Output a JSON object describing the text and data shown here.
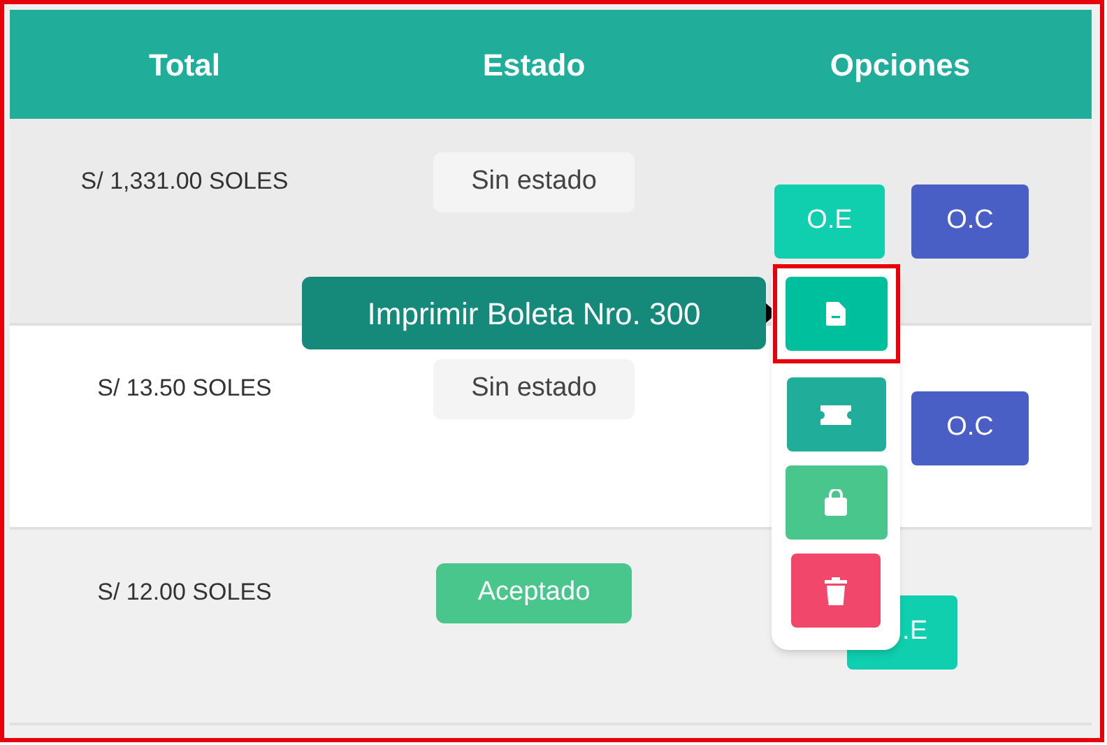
{
  "table": {
    "columns": [
      "Total",
      "Estado",
      "Opciones"
    ],
    "rows": [
      {
        "total": "S/ 1,331.00 SOLES",
        "status": {
          "label": "Sin estado",
          "kind": "none"
        },
        "options": [
          {
            "label": "O.E",
            "kind": "oe"
          },
          {
            "label": "O.C",
            "kind": "oc"
          }
        ]
      },
      {
        "total": "S/ 13.50 SOLES",
        "status": {
          "label": "Sin estado",
          "kind": "none"
        },
        "options": [
          {
            "label": "O.C",
            "kind": "oc"
          }
        ]
      },
      {
        "total": "S/ 12.00 SOLES",
        "status": {
          "label": "Aceptado",
          "kind": "accepted"
        },
        "options": [
          {
            "label": ".E",
            "kind": "oe"
          }
        ]
      }
    ]
  },
  "actions_menu": {
    "items": [
      {
        "kind": "document",
        "highlighted": true
      },
      {
        "kind": "ticket",
        "highlighted": false
      },
      {
        "kind": "bag",
        "highlighted": false
      },
      {
        "kind": "trash",
        "highlighted": false
      }
    ]
  },
  "tooltip": {
    "text": "Imprimir Boleta Nro. 300"
  }
}
